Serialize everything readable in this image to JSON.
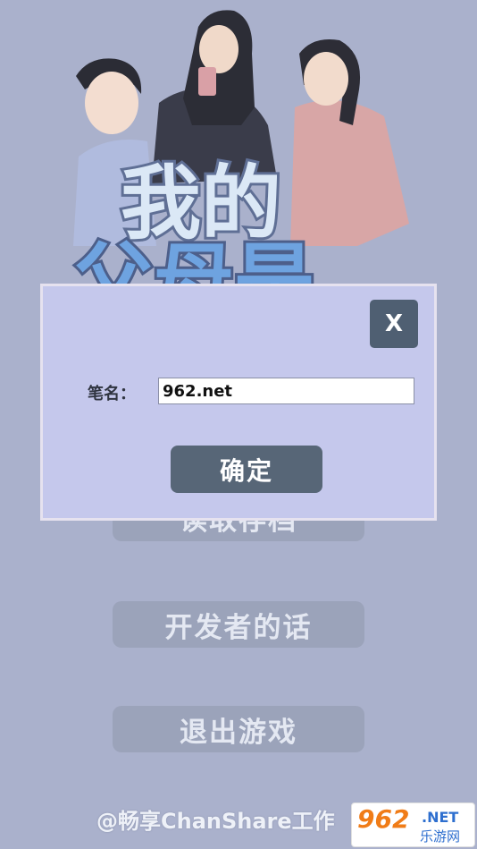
{
  "menu": {
    "load_label": "读取存档",
    "developer_label": "开发者的话",
    "exit_label": "退出游戏"
  },
  "footer": {
    "credit": "@畅享ChanShare工作"
  },
  "watermark": {
    "logo": "962",
    "net": ".NET",
    "sub": "乐游网"
  },
  "title_art": {
    "text": "我的父母是"
  },
  "dialog": {
    "close_label": "X",
    "name_label": "笔名：",
    "name_value": "962.net",
    "confirm_label": "确定"
  },
  "colors": {
    "background": "#aab1cc",
    "dialog": "#c5c8ec",
    "button_dark": "#576677",
    "menu_button": "#9ba3ba"
  }
}
